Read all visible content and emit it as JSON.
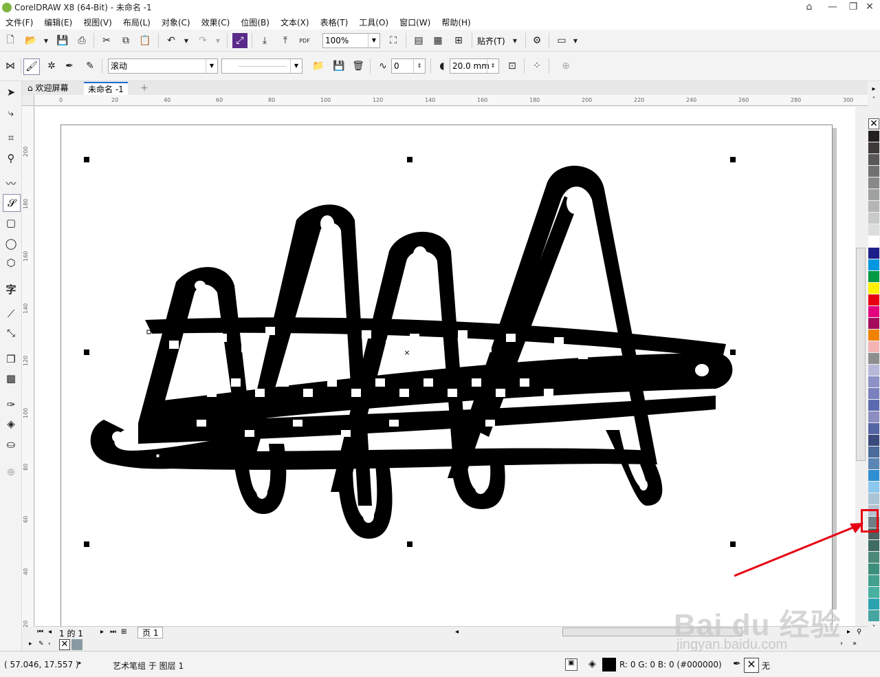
{
  "window": {
    "title": "CorelDRAW X8 (64-Bit) - 未命名 -1"
  },
  "menu": [
    "文件(F)",
    "编辑(E)",
    "视图(V)",
    "布局(L)",
    "对象(C)",
    "效果(C)",
    "位图(B)",
    "文本(X)",
    "表格(T)",
    "工具(O)",
    "窗口(W)",
    "帮助(H)"
  ],
  "standard_toolbar": {
    "zoom_value": "100%",
    "snap_label": "贴齐(T)",
    "pdf_label": "PDF"
  },
  "property_bar": {
    "brush_category": "滚动",
    "smoothing_value": "0",
    "stroke_width": "20.0 mm"
  },
  "tabs": {
    "welcome": "欢迎屏幕",
    "document": "未命名 -1"
  },
  "ruler": {
    "h_labels": [
      "0",
      "20",
      "40",
      "60",
      "80",
      "100",
      "120",
      "140",
      "160",
      "180",
      "200",
      "220",
      "240",
      "260",
      "280",
      "300"
    ],
    "v_labels": [
      "200",
      "180",
      "160",
      "140",
      "120",
      "100",
      "80",
      "60",
      "40",
      "20"
    ]
  },
  "page_nav": {
    "page_of": "1 的 1",
    "page_tab": "页 1"
  },
  "status": {
    "coords": "( 57.046, 17.557 )",
    "selection_info": "艺术笔组 于 图层 1",
    "fill_info": "R: 0 G: 0 B: 0 (#000000)",
    "outline_info": "无"
  },
  "palette": [
    "#231f20",
    "#3e3a39",
    "#595757",
    "#727171",
    "#898989",
    "#9fa0a0",
    "#b5b5b6",
    "#c9caca",
    "#dcdddd",
    "#ffffff",
    "#1d2088",
    "#0097e0",
    "#009944",
    "#fff100",
    "#e60012",
    "#e4007f",
    "#a40b5d",
    "#f08200",
    "#f4b4b4",
    "#8f8f8f",
    "#b6b8d9",
    "#8e91c6",
    "#7a7fbd",
    "#5c6ab0",
    "#8c8ec0",
    "#5566a5",
    "#3b4a7c",
    "#4a6b9c",
    "#5c87b5",
    "#2f8fd2",
    "#8cc8ee",
    "#aac4d6",
    "#b4c2cf",
    "#6f7f85",
    "#4d5f61",
    "#3e6b62",
    "#4b8a78",
    "#3d8f7d",
    "#41a08e",
    "#48b0a0",
    "#2ba4b0",
    "#46a5a0"
  ],
  "watermark": {
    "brand": "Bai du 经验",
    "url": "jingyan.baidu.com"
  },
  "colors": {
    "accent": "#1d6bd6",
    "highlight_box": "#e60012",
    "annotation_arrow": "#e60012"
  }
}
